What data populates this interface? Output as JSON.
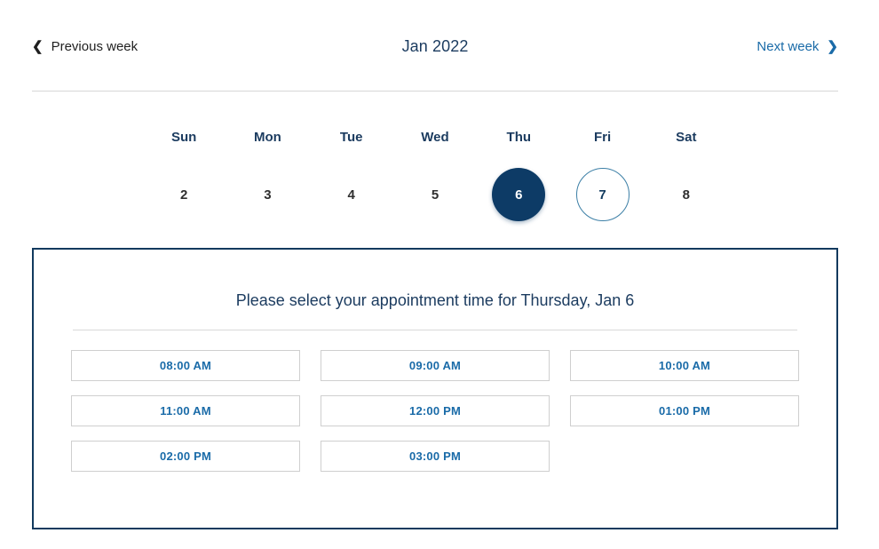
{
  "header": {
    "prev_label": "Previous week",
    "prev_icon": "chevron-left-icon",
    "next_label": "Next week",
    "next_icon": "chevron-right-icon",
    "month_title": "Jan 2022",
    "chevron_left_glyph": "❮",
    "chevron_right_glyph": "❯"
  },
  "week": {
    "day_names": [
      "Sun",
      "Mon",
      "Tue",
      "Wed",
      "Thu",
      "Fri",
      "Sat"
    ],
    "dates": [
      {
        "label": "2",
        "state": "plain"
      },
      {
        "label": "3",
        "state": "plain"
      },
      {
        "label": "4",
        "state": "plain"
      },
      {
        "label": "5",
        "state": "plain"
      },
      {
        "label": "6",
        "state": "selected"
      },
      {
        "label": "7",
        "state": "today"
      },
      {
        "label": "8",
        "state": "plain"
      }
    ]
  },
  "panel": {
    "title": "Please select your appointment time for Thursday, Jan 6",
    "slots": [
      "08:00 AM",
      "09:00 AM",
      "10:00 AM",
      "11:00 AM",
      "12:00 PM",
      "01:00 PM",
      "02:00 PM",
      "03:00 PM"
    ]
  },
  "colors": {
    "navy": "#123a5e",
    "selected_day_bg": "#0d3b66",
    "link_blue": "#1a6ba8",
    "today_ring": "#3c7fa6",
    "rule_gray": "#d7d7d7",
    "slot_border": "#cfcfcf"
  }
}
